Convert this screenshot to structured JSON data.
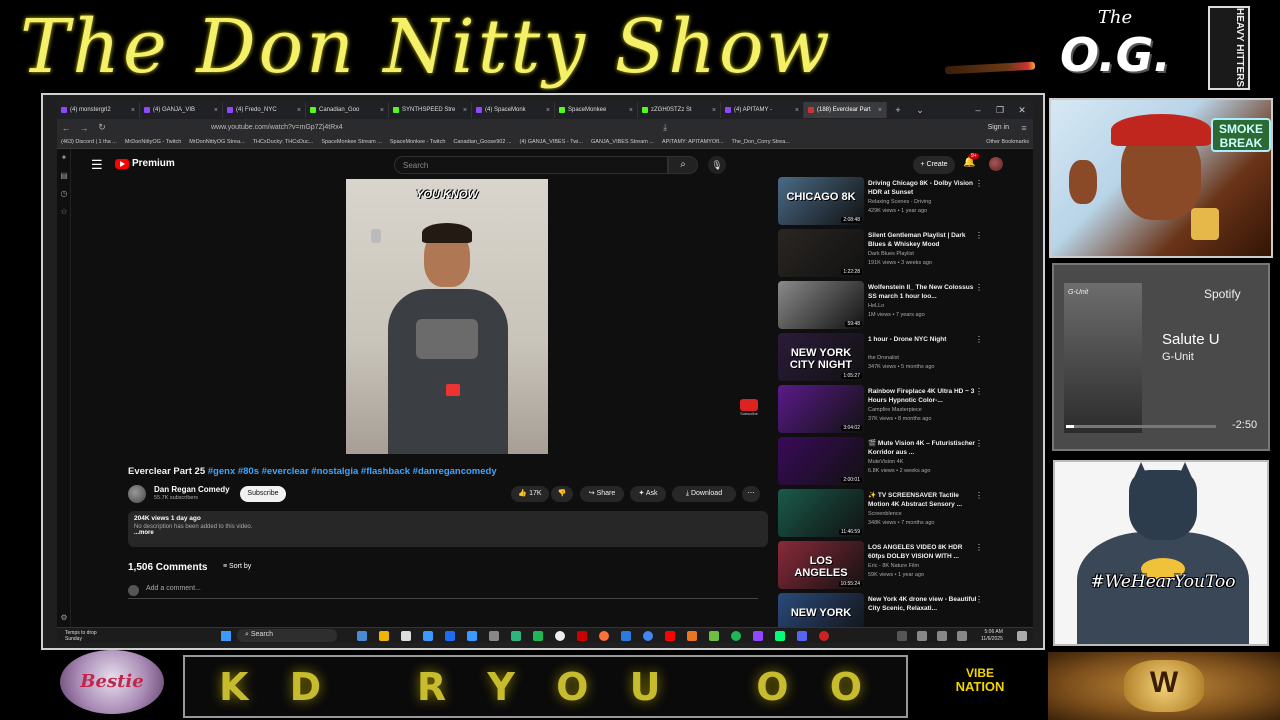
{
  "overlay": {
    "show_title": "The Don Nitty Show",
    "og_logo_the": "The",
    "og_logo_og": "O.G.",
    "heavy_hitters": "HEAVY HITTERS",
    "smoke_break": "SMOKE BREAK",
    "bestie": "Bestie",
    "ticker_text": "K D   R Y O U   O O",
    "vibe_nation_1": "VIBE",
    "vibe_nation_2": "NATION",
    "batman_hashtag": "#WeHearYouToo"
  },
  "spotify": {
    "logo": "Spotify",
    "track": "Salute U",
    "artist": "G-Unit",
    "album_label": "G-Unit",
    "time_remaining": "-2:50",
    "progress_fraction": 0.05
  },
  "browser": {
    "tabs": [
      {
        "label": "(4) monstergrl2",
        "active": false
      },
      {
        "label": "(4) GANJA_VIB",
        "active": false
      },
      {
        "label": "(4) Fredo_NYC",
        "active": false
      },
      {
        "label": "Canadian_Goo",
        "active": false
      },
      {
        "label": "SYNTHSPEED Stre",
        "active": false
      },
      {
        "label": "(4) SpaceMonk",
        "active": false
      },
      {
        "label": "SpaceMonkee",
        "active": false
      },
      {
        "label": "zZGH0STZz St",
        "active": false
      },
      {
        "label": "(4) APITAMY -",
        "active": false
      },
      {
        "label": "(188) Everclear Part",
        "active": true
      }
    ],
    "url": "www.youtube.com/watch?v=mGp7Zj4tRx4",
    "sign_in": "Sign in",
    "bookmarks": [
      "(463) Discord | 1 tha ...",
      "MrDonNittyOG - Twitch",
      "MrDonNittyOG Strea...",
      "THCxDucky: THCxDuc...",
      "SpaceMonkee Stream ...",
      "SpaceMonkee - Twitch",
      "Canadian_Goose902 ...",
      "(4) GANJA_VIBES - Twi...",
      "GANJA_VIBES Stream ...",
      "APITAMY: APITAMYOfl...",
      "The_Don_Corry Strea..."
    ],
    "bookmarks_other": "Other Bookmarks"
  },
  "youtube": {
    "logo_text": "Premium",
    "search_placeholder": "Search",
    "create_label": "Create",
    "notif_count": "9+",
    "caption": "YOU KNOW",
    "video_title": "Everclear Part 25",
    "video_tags": "#genx #80s #everclear #nostalgia #flashback #danregancomedy",
    "channel_name": "Dan Regan Comedy",
    "channel_subs": "55.7K subscribers",
    "subscribe_label": "Subscribe",
    "like_count": "17K",
    "share_label": "Share",
    "ask_label": "Ask",
    "download_label": "Download",
    "desc_views": "204K views  1 day ago",
    "desc_text": "No description has been added to this video.",
    "desc_more": "...more",
    "comments_count": "1,506 Comments",
    "sort_by": "Sort by",
    "add_comment_placeholder": "Add a comment...",
    "recommendations": [
      {
        "title": "Driving Chicago 8K - Dolby Vision HDR at Sunset",
        "channel": "Relaxing Scenes - Driving",
        "meta": "429K views • 1 year ago",
        "duration": "2:08:48",
        "thumb_text": "CHICAGO 8K",
        "thumb_color": "#4a6a86"
      },
      {
        "title": "Silent Gentleman Playlist | Dark Blues & Whiskey Mood",
        "channel": "Dark Blues Playlist",
        "meta": "191K views • 3 weeks ago",
        "duration": "1:22:28",
        "thumb_text": "",
        "thumb_color": "#2a2622"
      },
      {
        "title": "Wolfenstein II_ The New Colossus SS march 1 hour loo...",
        "channel": "HeLLo",
        "meta": "1M views • 7 years ago",
        "duration": "59:48",
        "thumb_text": "",
        "thumb_color": "#8a8a8a"
      },
      {
        "title": "1 hour - Drone NYC Night",
        "channel": "the Dronalist",
        "meta": "347K views • 5 months ago",
        "duration": "1:05:27",
        "thumb_text": "NEW YORK CITY NIGHT",
        "thumb_color": "#2b1b3a"
      },
      {
        "title": "Rainbow Fireplace 4K Ultra HD ~ 3 Hours Hypnotic Color-...",
        "channel": "Campfire Masterpiece",
        "meta": "37K views • 8 months ago",
        "duration": "3:04:02",
        "thumb_text": "",
        "thumb_color": "#5a1a8a"
      },
      {
        "title": "🎬 Mute Vision 4K – Futuristischer Korridor aus ...",
        "channel": "MuteVision 4K",
        "meta": "6.8K views • 2 weeks ago",
        "duration": "2:00:01",
        "thumb_text": "",
        "thumb_color": "#3a0a5a"
      },
      {
        "title": "✨ TV SCREENSAVER Tactile Motion 4K Abstract Sensory ...",
        "channel": "Screenblence",
        "meta": "348K views • 7 months ago",
        "duration": "11:46:59",
        "thumb_text": "",
        "thumb_color": "#1a5a4a"
      },
      {
        "title": "LOS ANGELES VIDEO 8K HDR 60fps DOLBY VISION WITH ...",
        "channel": "Eric - 8K Nature Film",
        "meta": "59K views • 1 year ago",
        "duration": "10:55:24",
        "thumb_text": "LOS ANGELES",
        "thumb_color": "#8a2a3a"
      },
      {
        "title": "New York 4K drone view - Beautiful City Scenic, Relaxati...",
        "channel": "",
        "meta": "",
        "duration": "",
        "thumb_text": "NEW YORK",
        "thumb_color": "#2a4a7a"
      }
    ]
  },
  "taskbar": {
    "weather_1": "Temps to drop",
    "weather_2": "Sunday",
    "search_label": "Search",
    "time": "5:06 AM",
    "date": "11/6/2025"
  }
}
